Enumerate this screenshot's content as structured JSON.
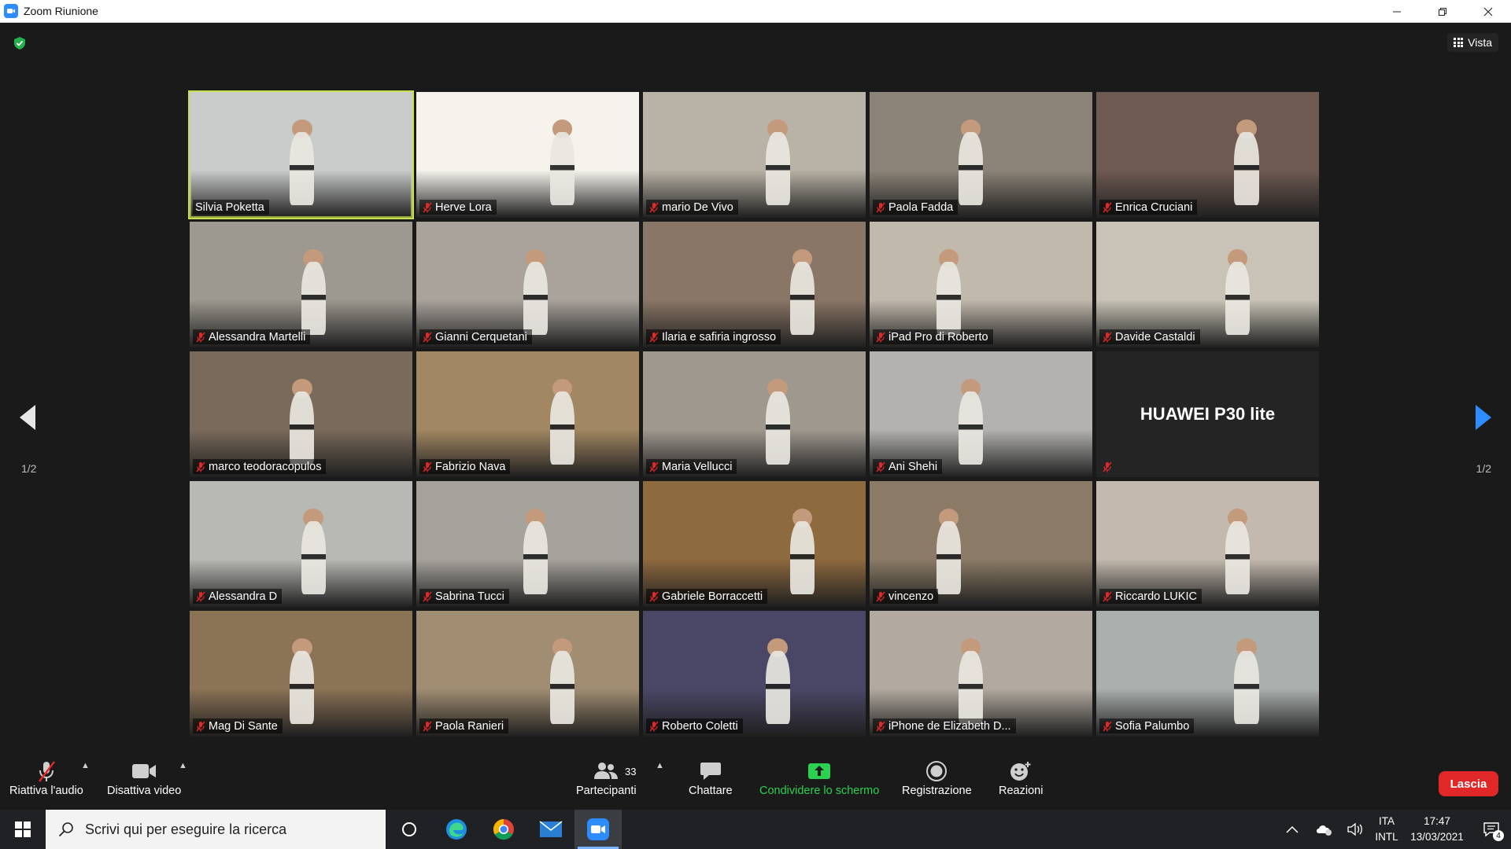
{
  "window": {
    "title": "Zoom Riunione"
  },
  "view_button": {
    "label": "Vista"
  },
  "pagination": {
    "left": "1/2",
    "right": "1/2"
  },
  "participants_tiles": [
    {
      "name": "Silvia Poketta",
      "muted": false,
      "active": true,
      "bg": "#c9ccca"
    },
    {
      "name": "Herve Lora",
      "muted": true,
      "bg": "#f5f3ec"
    },
    {
      "name": "mario De Vivo",
      "muted": true,
      "bg": "#b9b2a6"
    },
    {
      "name": "Paola Fadda",
      "muted": true,
      "bg": "#8c8478"
    },
    {
      "name": "Enrica Cruciani",
      "muted": true,
      "bg": "#6f5a52"
    },
    {
      "name": "Alessandra Martelli",
      "muted": true,
      "bg": "#9d9890"
    },
    {
      "name": "Gianni Cerquetani",
      "muted": true,
      "bg": "#a9a39c"
    },
    {
      "name": "Ilaria e safiria ingrosso",
      "muted": true,
      "bg": "#8a7666"
    },
    {
      "name": "iPad Pro di Roberto",
      "muted": true,
      "bg": "#c2b9ad"
    },
    {
      "name": "Davide Castaldi",
      "muted": true,
      "bg": "#c8c3b6"
    },
    {
      "name": "marco teodoracopulos",
      "muted": true,
      "bg": "#7a6a5b"
    },
    {
      "name": "Fabrizio Nava",
      "muted": true,
      "bg": "#a28862"
    },
    {
      "name": "Maria Vellucci",
      "muted": true,
      "bg": "#9f988f"
    },
    {
      "name": "Ani Shehi",
      "muted": true,
      "bg": "#b3b2b0"
    },
    {
      "device": "HUAWEI P30 lite",
      "muted": true,
      "placeholder": true
    },
    {
      "name": "Alessandra D",
      "muted": true,
      "bg": "#b8b8b4"
    },
    {
      "name": "Sabrina Tucci",
      "muted": true,
      "bg": "#a6a29c"
    },
    {
      "name": "Gabriele Borraccetti",
      "muted": true,
      "bg": "#8e6a3f"
    },
    {
      "name": "vincenzo",
      "muted": true,
      "bg": "#8b7b66"
    },
    {
      "name": "Riccardo LUKIC",
      "muted": true,
      "bg": "#c3b9ae"
    },
    {
      "name": "Mag Di Sante",
      "muted": true,
      "bg": "#8b7356"
    },
    {
      "name": "Paola Ranieri",
      "muted": true,
      "bg": "#a08d72"
    },
    {
      "name": "Roberto Coletti",
      "muted": true,
      "bg": "#4a4766"
    },
    {
      "name": "iPhone de Elizabeth D...",
      "muted": true,
      "bg": "#b2aaa0"
    },
    {
      "name": "Sofia Palumbo",
      "muted": true,
      "bg": "#aab0ad"
    }
  ],
  "toolbar": {
    "audio": "Riattiva l'audio",
    "video": "Disattiva video",
    "participants": "Partecipanti",
    "participants_count": "33",
    "chat": "Chattare",
    "share": "Condividere lo schermo",
    "record": "Registrazione",
    "reactions": "Reazioni",
    "leave": "Lascia"
  },
  "taskbar": {
    "search_placeholder": "Scrivi qui per eseguire la ricerca",
    "lang_top": "ITA",
    "lang_bottom": "INTL",
    "time": "17:47",
    "date": "13/03/2021",
    "notifications": "4"
  },
  "colors": {
    "active_speaker": "#c6e050",
    "leave": "#e02828",
    "share": "#2bd14f",
    "accent": "#2d8cff"
  }
}
